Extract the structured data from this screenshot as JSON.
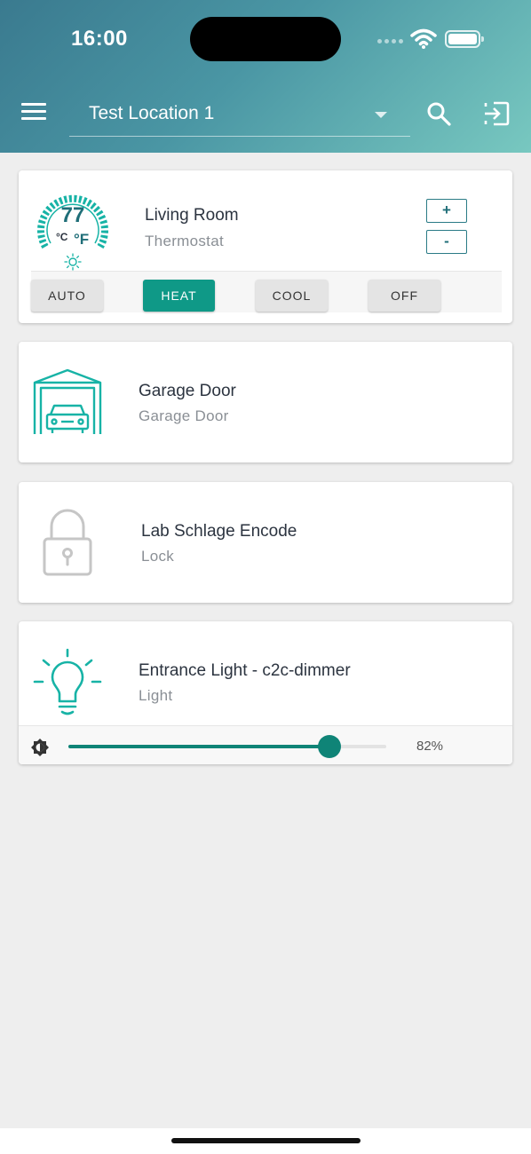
{
  "status_bar": {
    "time": "16:00"
  },
  "header": {
    "location": "Test Location 1",
    "menu_icon": "menu-icon",
    "search_icon": "search-icon",
    "logout_icon": "logout-icon"
  },
  "colors": {
    "accent": "#0f9987",
    "header_start": "#3a7a8f",
    "header_end": "#78c8c0",
    "background": "#eeeeee"
  },
  "devices": {
    "thermostat": {
      "name": "Living Room",
      "type": "Thermostat",
      "temperature": "77",
      "unit_c": "°C",
      "unit_f": "°F",
      "increase_label": "+",
      "decrease_label": "-",
      "modes": [
        "AUTO",
        "HEAT",
        "COOL",
        "OFF"
      ],
      "active_mode": "HEAT"
    },
    "garage": {
      "name": "Garage Door",
      "type": "Garage Door",
      "icon": "garage-car-icon"
    },
    "lock": {
      "name": "Lab Schlage Encode",
      "type": "Lock",
      "icon": "padlock-icon"
    },
    "light": {
      "name": "Entrance Light - c2c-dimmer",
      "type": "Light",
      "icon": "lightbulb-icon",
      "brightness_percent": 82,
      "brightness_label": "82%"
    }
  }
}
